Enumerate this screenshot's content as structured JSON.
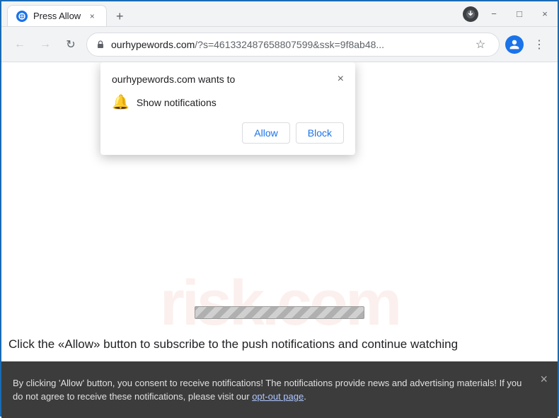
{
  "window": {
    "title": "Press Allow",
    "minimize": "−",
    "maximize": "□",
    "close": "×"
  },
  "tabs": [
    {
      "label": "Press Allow",
      "active": true
    }
  ],
  "addressbar": {
    "url_display": "ourhypewords.com",
    "url_query": "/?s=461332487658807599&ssk=9f8ab48...",
    "full_url": "ourhypewords.com/?s=461332487658807599&ssk=9f8ab48..."
  },
  "notification_popup": {
    "title": "ourhypewords.com wants to",
    "close_label": "×",
    "notification_row": {
      "icon": "🔔",
      "text": "Show notifications"
    },
    "allow_label": "Allow",
    "block_label": "Block"
  },
  "cta_text": "Click the «Allow» button to subscribe to the push notifications and continue watching",
  "consent_bar": {
    "text": "By clicking 'Allow' button, you consent to receive notifications! The notifications provide news and advertising materials! If you do not agree to receive these notifications, please visit our ",
    "link_text": "opt-out page",
    "end_text": ".",
    "close": "×"
  },
  "watermark": {
    "risk_text": "risk.com"
  }
}
